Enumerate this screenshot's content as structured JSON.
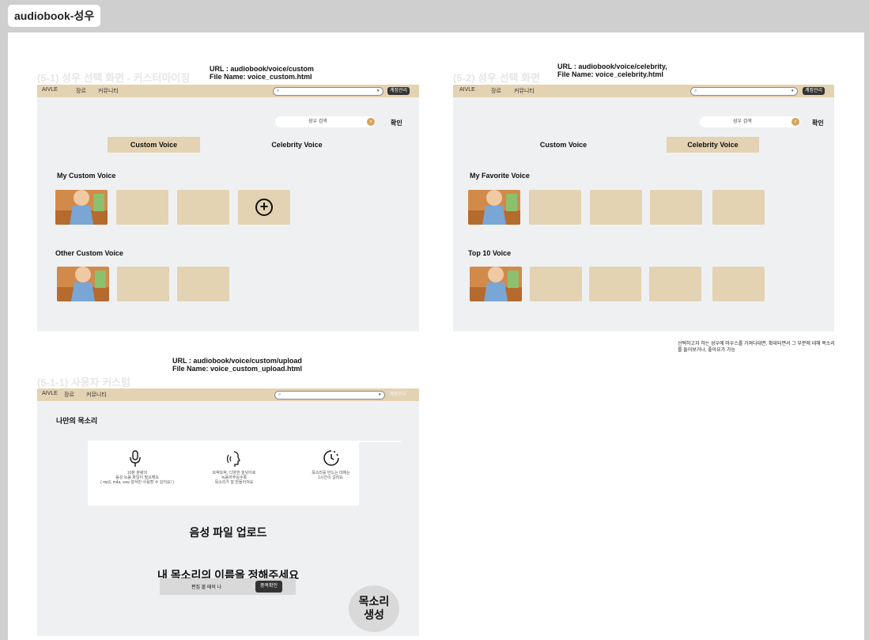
{
  "page_tab": "audiobook-성우",
  "shared_nav": {
    "brand": "AIVLE",
    "menu1": "장르",
    "menu2": "커뮤니티",
    "account": "계정관리"
  },
  "panel_a": {
    "section_title": "(5-1) 성우 선택 화면 - 커스터마이징",
    "url_line": "URL : audiobook/voice/custom",
    "file_line": "File Name: voice_custom.html",
    "search_placeholder": "성우 검색",
    "confirm": "확인",
    "tab1": "Custom Voice",
    "tab2": "Celebrity Voice",
    "row1_label": "My Custom Voice",
    "row2_label": "Other Custom Voice"
  },
  "panel_b": {
    "section_title": "(5-2) 성우 선택 화면",
    "url_line": "URL : audiobook/voice/celebrity,",
    "file_line": "File Name: voice_celebrity.html",
    "search_placeholder": "성우 검색",
    "confirm": "확인",
    "tab1": "Custom Voice",
    "tab2": "Celebrity Voice",
    "row1_label": "My Favorite Voice",
    "row2_label": "Top 10 Voice",
    "note": "선택하고자 하는 성우에 마우스를 가져다대면, 확대되면서 그 부분에 대해 목소리를 들어보거나, 좋아요가 가능"
  },
  "panel_c": {
    "section_title": "(5-1-1) 사용자 커스텀",
    "url_line": "URL : audiobook/voice/custom/upload",
    "file_line": "File Name: voice_custom_upload.html",
    "heading": "나만의 목소리",
    "feat1_line1": "10분 분량의",
    "feat1_line2": "음성 녹음 파일이 필요해요",
    "feat1_line3": "( mp3, m4a, wav 형식만 사용할 수 있어요! )",
    "feat2_line1": "또박또박, 다양한 높낮이로",
    "feat2_line2": "녹음하주실수록",
    "feat2_line3": "목소리가 잘 만들어져요",
    "feat3_line1": "목소리를 만드는 데에는",
    "feat3_line2": "1시간이 걸려요.",
    "upload_label": "음성 파일 업로드",
    "name_title": "내 목소리의 이름을 정해주세요",
    "name_value": "편집 볼 때의 나",
    "dup_button": "중복확인",
    "create_line1": "목소리",
    "create_line2": "생성"
  }
}
